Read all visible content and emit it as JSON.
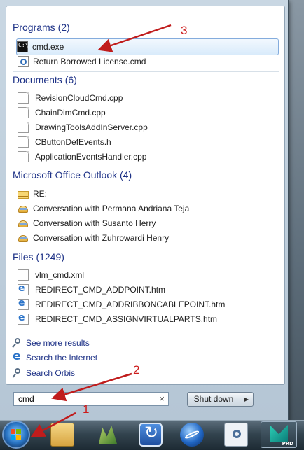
{
  "groups": {
    "programs": {
      "title": "Programs (2)",
      "items": [
        {
          "label": "cmd.exe",
          "icon": "cmd-icon"
        },
        {
          "label": "Return Borrowed License.cmd",
          "icon": "script-icon"
        }
      ]
    },
    "documents": {
      "title": "Documents (6)",
      "items": [
        {
          "label": "RevisionCloudCmd.cpp"
        },
        {
          "label": "ChainDimCmd.cpp"
        },
        {
          "label": "DrawingToolsAddInServer.cpp"
        },
        {
          "label": "CButtonDefEvents.h"
        },
        {
          "label": "ApplicationEventsHandler.cpp"
        }
      ]
    },
    "outlook": {
      "title": "Microsoft Office Outlook (4)",
      "items": [
        {
          "label": "RE:"
        },
        {
          "label": "Conversation with Permana Andriana Teja"
        },
        {
          "label": "Conversation with Susanto Herry"
        },
        {
          "label": "Conversation with Zuhrowardi Henry"
        }
      ]
    },
    "files": {
      "title": "Files (1249)",
      "items": [
        {
          "label": "vlm_cmd.xml"
        },
        {
          "label": "REDIRECT_CMD_ADDPOINT.htm"
        },
        {
          "label": "REDIRECT_CMD_ADDRIBBONCABLEPOINT.htm"
        },
        {
          "label": "REDIRECT_CMD_ASSIGNVIRTUALPARTS.htm"
        }
      ]
    }
  },
  "links": {
    "see_more": "See more results",
    "search_internet": "Search the Internet",
    "search_orbis": "Search Orbis"
  },
  "search": {
    "value": "cmd",
    "clear_glyph": "×"
  },
  "shutdown": {
    "label": "Shut down",
    "arrow": "▶"
  },
  "annotations": {
    "n1": "1",
    "n2": "2",
    "n3": "3"
  },
  "taskbar": {
    "prd_tag": "PRD"
  },
  "colors": {
    "group_title": "#1e3287",
    "selection_border": "#84acdd",
    "annotation": "#cc1a1a"
  }
}
